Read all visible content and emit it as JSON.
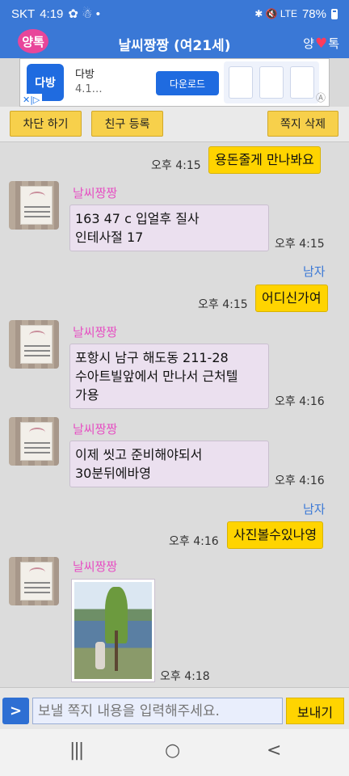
{
  "status_bar": {
    "carrier": "SKT",
    "time": "4:19",
    "battery": "78%",
    "left_icons": "✿ ☃ •",
    "right_icons": "✱ 🔇 LTE"
  },
  "header": {
    "logo": "양톡",
    "title": "날씨짱짱 (여21세)",
    "brand_left": "양",
    "brand_heart": "♥",
    "brand_right": "톡"
  },
  "ad": {
    "icon_text": "다방",
    "title": "다방",
    "subtitle": "4.1…",
    "cta": "다운로드",
    "adchoice": "✕|▷",
    "marker": "Ⓐ"
  },
  "toolbar": {
    "block": "차단 하기",
    "add_friend": "친구 등록",
    "delete_msg": "쪽지 삭제"
  },
  "messages": [
    {
      "from": "me",
      "text": "용돈줄게 만나봐요",
      "time": "오후 4:15"
    },
    {
      "from": "them",
      "name": "날씨짱짱",
      "lines": [
        "163 47 c  입얼후 질사",
        "인테사절  17"
      ],
      "time": "오후 4:15"
    },
    {
      "from": "me",
      "name": "남자",
      "text": "어디신가여",
      "time": "오후 4:15"
    },
    {
      "from": "them",
      "name": "날씨짱짱",
      "lines": [
        "포항시 남구 해도동 211-28",
        "수아트빌앞에서 만나서 근처텔",
        "가용"
      ],
      "time": "오후 4:16"
    },
    {
      "from": "them",
      "name": "날씨짱짱",
      "lines": [
        "이제 씻고 준비해야되서",
        "30분뒤에바영"
      ],
      "time": "오후 4:16"
    },
    {
      "from": "me",
      "name": "남자",
      "text": "사진볼수있나영",
      "time": "오후 4:16"
    },
    {
      "from": "them",
      "name": "날씨짱짱",
      "photo": true,
      "time": "오후 4:18"
    }
  ],
  "avatar_caption": [
    "love",
    "happiness",
    "destiny"
  ],
  "input": {
    "expand": ">",
    "placeholder": "보낼 쪽지 내용을 입력해주세요.",
    "send": "보내기"
  },
  "nav": {
    "recent": "|||",
    "home": "○",
    "back": "<"
  },
  "colors": {
    "header": "#3a78d6",
    "my_bubble": "#ffd400",
    "their_bubble": "#ebe0ef",
    "their_name": "#e651c3",
    "my_name": "#3a78d6"
  }
}
